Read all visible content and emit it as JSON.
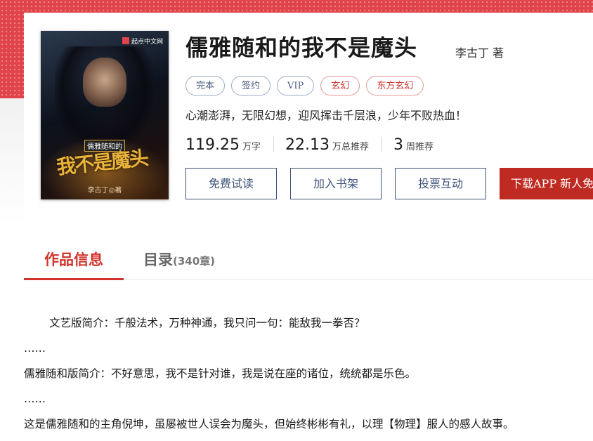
{
  "book": {
    "title": "儒雅随和的我不是魔头",
    "author_line": "李古丁  著",
    "tags": [
      {
        "label": "完本",
        "style": "blue"
      },
      {
        "label": "签约",
        "style": "blue"
      },
      {
        "label": "VIP",
        "style": "blue"
      },
      {
        "label": "玄幻",
        "style": "red"
      },
      {
        "label": "东方玄幻",
        "style": "red"
      }
    ],
    "intro": "心潮澎湃，无限幻想，迎风挥击千层浪，少年不败热血！",
    "stats": [
      {
        "value": "119.25",
        "unit": "万字"
      },
      {
        "value": "22.13",
        "unit": "万总推荐"
      },
      {
        "value": "3",
        "unit": "周推荐"
      }
    ]
  },
  "cover": {
    "logo": "起点中文网",
    "subtitle": "儒雅随和的",
    "big_title": "我不是魔头",
    "author": "李古丁◎著"
  },
  "actions": {
    "free_read": "免费试读",
    "add_shelf": "加入书架",
    "vote": "投票互动",
    "download": "下载APP  新人免"
  },
  "tabs": {
    "info": "作品信息",
    "toc": "目录",
    "toc_count": "(340章)"
  },
  "description": [
    "文艺版简介：千般法术，万种神通，我只问一句：能敌我一拳否？",
    "……",
    "儒雅随和版简介：不好意思，我不是针对谁，我是说在座的诸位，统统都是乐色。",
    "……",
    "这是儒雅随和的主角倪坤，虽屡被世人误会为魔头，但始终彬彬有礼，以理【物理】服人的感人故事。"
  ],
  "colors": {
    "accent_red": "#d0342c",
    "button_blue": "#3e527a",
    "download_bg": "#bf2b22"
  }
}
